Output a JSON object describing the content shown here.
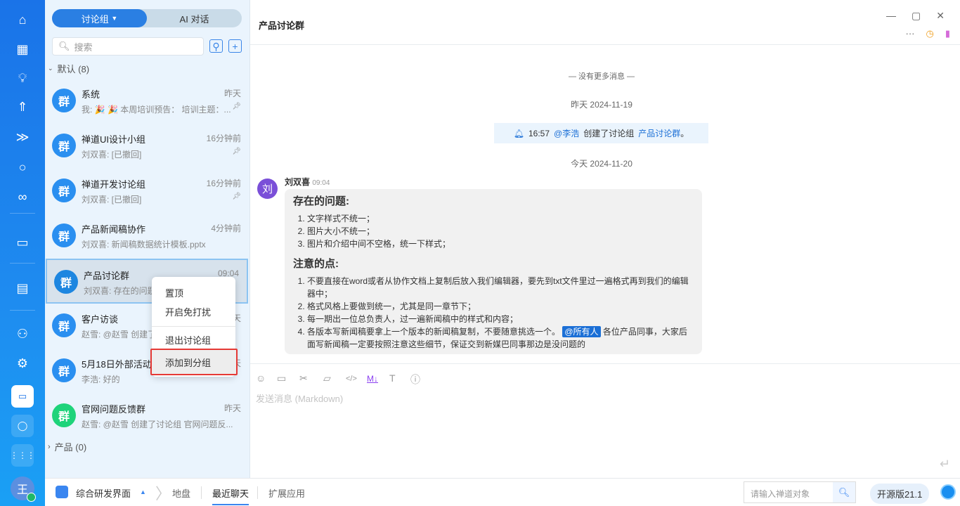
{
  "nav": {
    "icons": [
      "home-icon",
      "grid-icon",
      "bulb-icon",
      "rocket-icon",
      "sprint-icon",
      "search-icon",
      "infinity-icon",
      "presentation-icon",
      "document-icon",
      "users-icon",
      "gear-icon",
      "chat-icon",
      "user-icon",
      "apps-icon"
    ],
    "avatar": "王"
  },
  "list": {
    "tabs": [
      "讨论组",
      "AI 对话"
    ],
    "search_placeholder": "搜索",
    "group_default": "默认 (8)",
    "group_product": "产品 (0)",
    "avatar_text": "群",
    "items": [
      {
        "name": "系统",
        "time": "昨天",
        "preview": "我: 🎉 🎉 本周培训预告： 培训主题：...",
        "pinned": true,
        "color": "#2a8ff0"
      },
      {
        "name": "禅道UI设计小组",
        "time": "16分钟前",
        "preview": "刘双喜: [已撤回]",
        "pinned": true,
        "color": "#2a8ff0"
      },
      {
        "name": "禅道开发讨论组",
        "time": "16分钟前",
        "preview": "刘双喜: [已撤回]",
        "pinned": true,
        "color": "#2a8ff0"
      },
      {
        "name": "产品新闻稿协作",
        "time": "4分钟前",
        "preview": "刘双喜: 新闻稿数据统计模板.pptx",
        "pinned": false,
        "color": "#2a8ff0"
      },
      {
        "name": "产品讨论群",
        "time": "09:04",
        "preview": "刘双喜: 存在的问题...",
        "pinned": false,
        "color": "#1d86e0"
      },
      {
        "name": "客户访谈",
        "time": "昨天",
        "preview": "赵雪: @赵雪 创建了讨论组 客户访谈",
        "pinned": false,
        "color": "#2a8ff0"
      },
      {
        "name": "5月18日外部活动",
        "time": "昨天",
        "preview": "李浩: 好的",
        "pinned": false,
        "color": "#2a8ff0"
      },
      {
        "name": "官网问题反馈群",
        "time": "昨天",
        "preview": "赵雪: @赵雪 创建了讨论组 官网问题反...",
        "pinned": false,
        "color": "#1ed37a"
      }
    ]
  },
  "context_menu": [
    "置顶",
    "开启免打扰",
    "退出讨论组",
    "添加到分组"
  ],
  "chat": {
    "title": "产品讨论群",
    "no_more": "— 没有更多消息 —",
    "date1": "昨天 2024-11-19",
    "notice": {
      "time": "16:57",
      "user": "@李浩",
      "text": "创建了讨论组",
      "group": "产品讨论群",
      "end": "。"
    },
    "date2": "今天 2024-11-20",
    "message": {
      "avatar": "刘",
      "sender": "刘双喜",
      "time": "09:04",
      "h1": "存在的问题:",
      "list1": [
        "文字样式不统一；",
        "图片大小不统一；",
        "图片和介绍中间不空格，统一下样式；"
      ],
      "h2": "注意的点:",
      "list2": [
        "不要直接在word或者从协作文档上复制后放入我们编辑器，要先到txt文件里过一遍格式再到我们的编辑器中；",
        "格式风格上要做到统一，尤其是同一章节下；",
        "每一期出一位总负责人，过一遍新闻稿中的样式和内容；"
      ],
      "item4_a": "各版本写新闻稿要拿上一个版本的新闻稿复制，不要随意挑选一个。",
      "item4_at": "@所有人",
      "item4_b": "各位产品同事，大家后面写新闻稿一定要按照注意这些细节，保证交到新媒巴同事那边是没问题的"
    },
    "input_placeholder": "发送消息 (Markdown)",
    "md_label": "M↓"
  },
  "bottom": {
    "app": "综合研发界面",
    "crumbs": [
      "地盘",
      "最近聊天",
      "扩展应用"
    ],
    "search_placeholder": "请输入禅道对象",
    "version": "开源版21.1"
  }
}
